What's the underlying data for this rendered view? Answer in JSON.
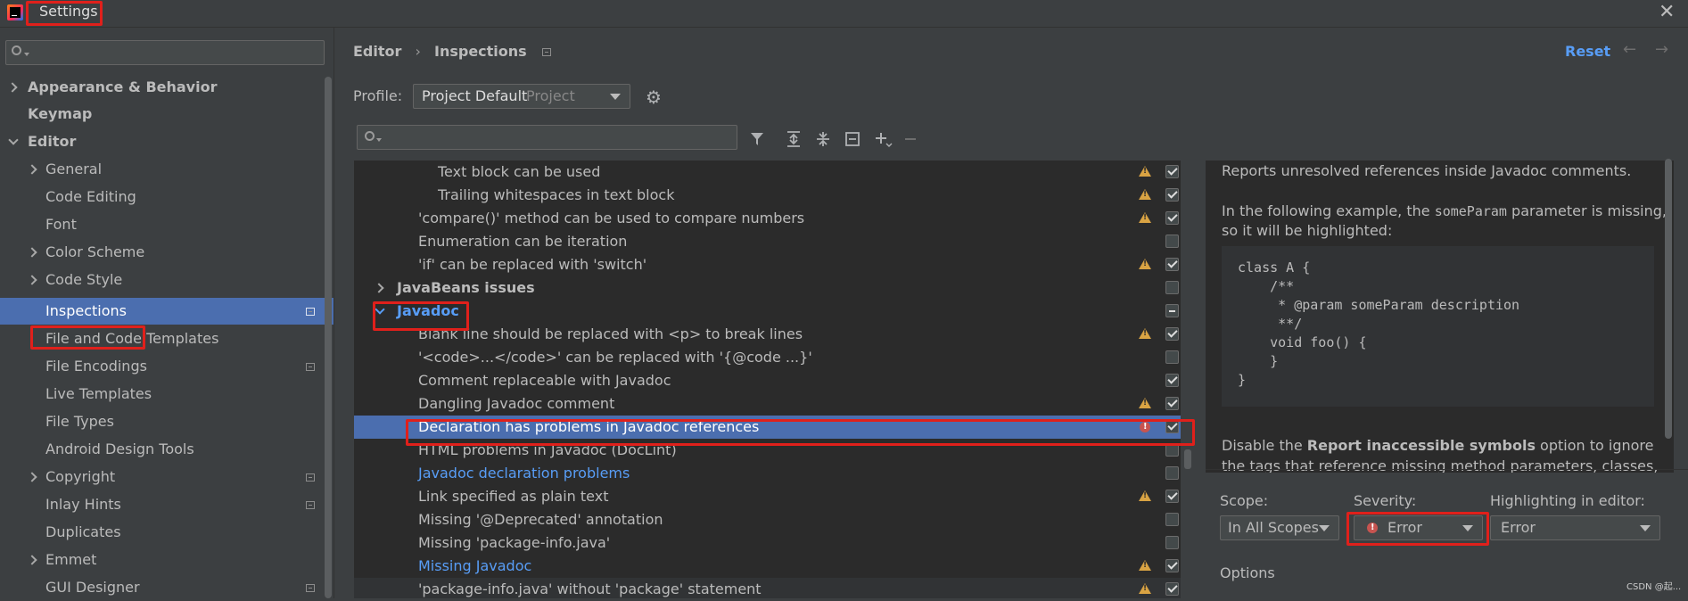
{
  "window": {
    "title": "Settings",
    "close_icon": "close-icon"
  },
  "sidebar": {
    "search_placeholder": "",
    "items": [
      {
        "label": "Appearance & Behavior"
      },
      {
        "label": "Keymap"
      },
      {
        "label": "Editor"
      },
      {
        "label": "General"
      },
      {
        "label": "Code Editing"
      },
      {
        "label": "Font"
      },
      {
        "label": "Color Scheme"
      },
      {
        "label": "Code Style"
      },
      {
        "label": "Inspections"
      },
      {
        "label": "File and Code Templates"
      },
      {
        "label": "File Encodings"
      },
      {
        "label": "Live Templates"
      },
      {
        "label": "File Types"
      },
      {
        "label": "Android Design Tools"
      },
      {
        "label": "Copyright"
      },
      {
        "label": "Inlay Hints"
      },
      {
        "label": "Duplicates"
      },
      {
        "label": "Emmet"
      },
      {
        "label": "GUI Designer"
      }
    ]
  },
  "header": {
    "breadcrumb_root": "Editor",
    "breadcrumb_sep": "›",
    "breadcrumb_current": "Inspections",
    "reset_label": "Reset",
    "back_arrow": "←",
    "forward_arrow": "→"
  },
  "profile": {
    "label": "Profile:",
    "value": "Project Default",
    "scope": "Project"
  },
  "tree": {
    "rows": [
      {
        "label": "Text block can be used"
      },
      {
        "label": "Trailing whitespaces in text block"
      },
      {
        "label": "'compare()' method can be used to compare numbers"
      },
      {
        "label": "Enumeration can be iteration"
      },
      {
        "label": "'if' can be replaced with 'switch'"
      },
      {
        "label": "JavaBeans issues"
      },
      {
        "label": "Javadoc"
      },
      {
        "label": "Blank line should be replaced with <p> to break lines"
      },
      {
        "label": "'<code>...</code>' can be replaced with '{@code ...}'"
      },
      {
        "label": "Comment replaceable with Javadoc"
      },
      {
        "label": "Dangling Javadoc comment"
      },
      {
        "label": "Declaration has problems in Javadoc references"
      },
      {
        "label": "HTML problems in Javadoc (DocLint)"
      },
      {
        "label": "Javadoc declaration problems"
      },
      {
        "label": "Link specified as plain text"
      },
      {
        "label": "Missing '@Deprecated' annotation"
      },
      {
        "label": "Missing 'package-info.java'"
      },
      {
        "label": "Missing Javadoc"
      },
      {
        "label": "'package-info.java' without 'package' statement"
      }
    ]
  },
  "description": {
    "line1": "Reports unresolved references inside Javadoc comments.",
    "example_prefix": "In the following example, the ",
    "example_code": "someParam",
    "example_suffix": " parameter is missing, so it will be highlighted:",
    "code": "class A {\n    /**\n     * @param someParam description\n     **/\n    void foo() {\n    }\n}",
    "disable_prefix": "Disable the ",
    "disable_bold": "Report inaccessible symbols",
    "disable_suffix": " option to ignore the tags that reference missing method parameters, classes, fields"
  },
  "settings": {
    "scope_label": "Scope:",
    "scope_value": "In All Scopes",
    "severity_label": "Severity:",
    "severity_value": "Error",
    "highlighting_label": "Highlighting in editor:",
    "highlighting_value": "Error",
    "options_label": "Options"
  },
  "watermark": "CSDN @起..."
}
